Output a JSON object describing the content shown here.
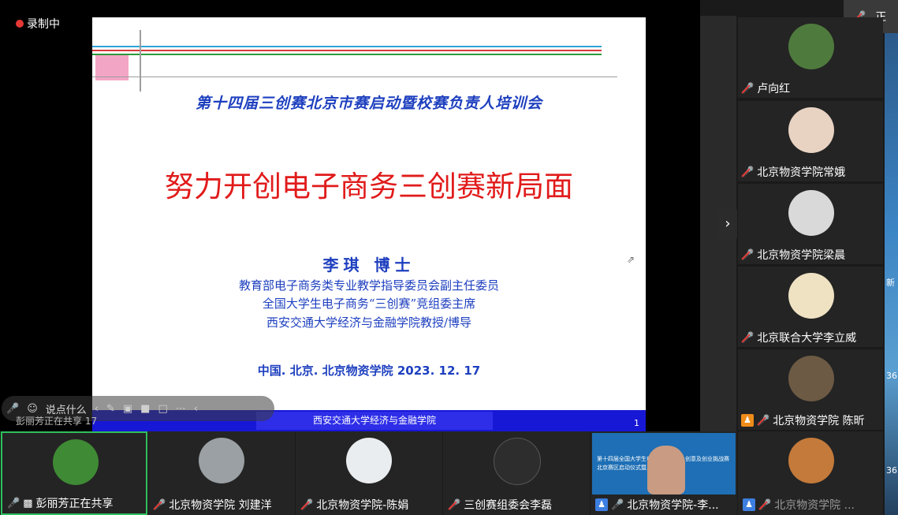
{
  "recording": {
    "label": "录制中"
  },
  "top_right": {
    "label": "正"
  },
  "slide": {
    "event": "第十四届三创赛北京市赛启动暨校赛负责人培训会",
    "title": "努力开创电子商务三创赛新局面",
    "author": "李琪  博士",
    "roles": [
      "教育部电子商务类专业教学指导委员会副主任委员",
      "全国大学生电子商务“三创赛”竞组委主席",
      "西安交通大学经济与金融学院教授/博导"
    ],
    "place_date": "中国. 北京. 北京物资学院  2023. 12. 17",
    "footer": "西安交通大学经济与金融学院",
    "page": "1"
  },
  "toolbar": {
    "say_something": "说点什么",
    "share_caption": "彭丽芳正在共享 17"
  },
  "right_edge": {
    "t1": "新",
    "t2": "36",
    "t3": "36"
  },
  "participants_right": [
    {
      "name": "卢向红",
      "avatar_color": "#4f7a3d"
    },
    {
      "name": "北京物资学院常娥",
      "avatar_color": "#e8d3c3"
    },
    {
      "name": "北京物资学院梁晨",
      "avatar_color": "#d9d9d9"
    },
    {
      "name": "北京联合大学李立威",
      "avatar_color": "#efe2c3"
    },
    {
      "name": "北京物资学院 陈昕",
      "avatar_color": "#6d5a44"
    }
  ],
  "participants_bottom": [
    {
      "name": "彭丽芳正在共享",
      "avatar_color": "#3f8a34"
    },
    {
      "name": "北京物资学院 刘建洋",
      "avatar_color": "#9aa0a3"
    },
    {
      "name": "北京物资学院-陈娟",
      "avatar_color": "#e9edf0"
    },
    {
      "name": "三创赛组委会李磊",
      "avatar_color": "#2d2d2d"
    },
    {
      "name": "北京物资学院-李...",
      "video_text": "第十四届全国大学生电子商务创新、创意及创业挑战赛北京赛区启动仪式暨人培训会"
    },
    {
      "name": "北京物资学院 ...",
      "avatar_color": "#c47a3a"
    }
  ]
}
